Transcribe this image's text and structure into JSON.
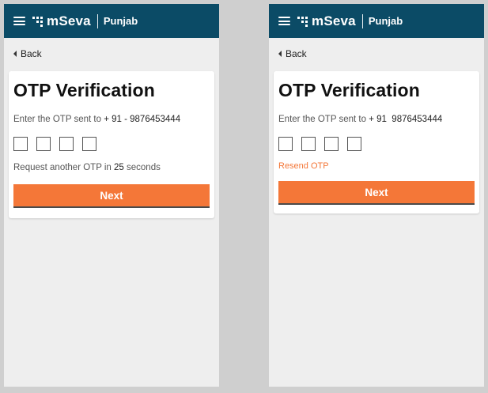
{
  "header": {
    "brand": "mSeva",
    "city": "Punjab"
  },
  "back_label": "Back",
  "screens": [
    {
      "title": "OTP Verification",
      "sent_prefix": "Enter the OTP sent to",
      "phone_number": "+ 91 - 9876453444",
      "otp_digits": [
        "",
        "",
        "",
        ""
      ],
      "request_prefix": "Request another OTP in",
      "request_seconds": "25",
      "request_suffix": "seconds",
      "next_label": "Next"
    },
    {
      "title": "OTP Verification",
      "sent_prefix": "Enter the OTP sent to",
      "phone_number": "+ 91  9876453444",
      "otp_digits": [
        "",
        "",
        "",
        ""
      ],
      "resend_label": "Resend OTP",
      "next_label": "Next"
    }
  ],
  "colors": {
    "header_bg": "#0b4b66",
    "accent": "#f47738",
    "page_bg": "#eeeeee"
  },
  "icons": [
    "menu-icon",
    "mseva-logo-icon",
    "back-caret-icon"
  ]
}
